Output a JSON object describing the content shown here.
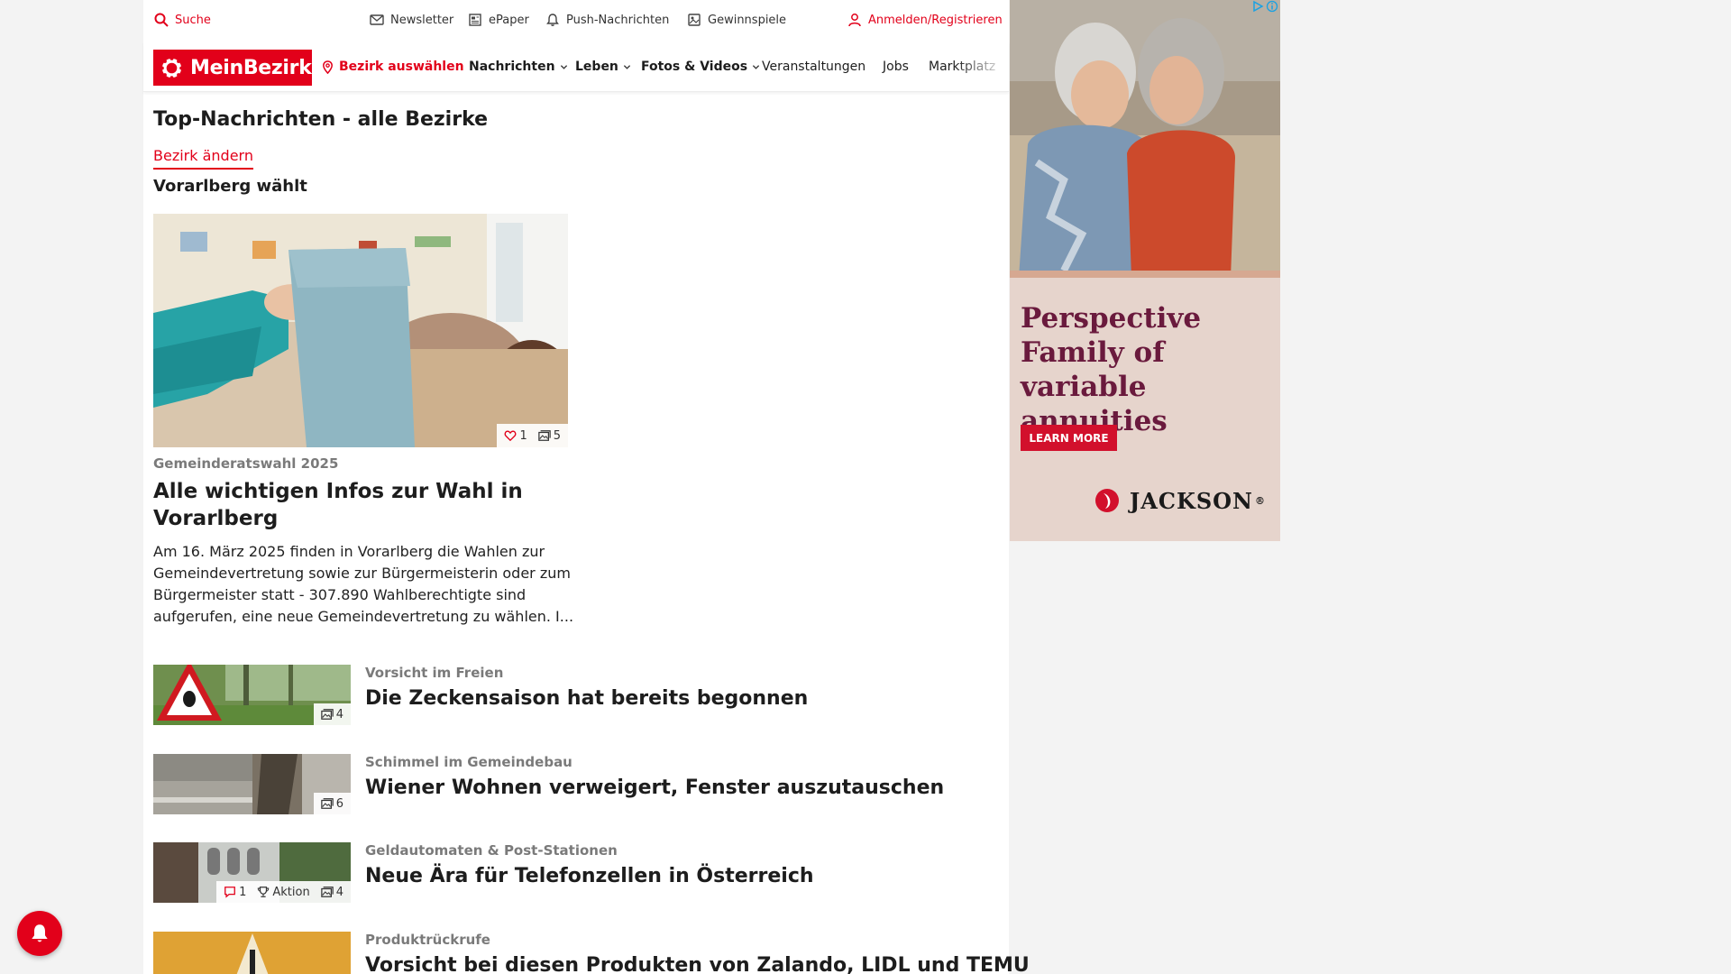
{
  "util_bar": {
    "search": "Suche",
    "newsletter": "Newsletter",
    "epaper": "ePaper",
    "push": "Push-Nachrichten",
    "contests": "Gewinnspiele",
    "login": "Anmelden/Registrieren"
  },
  "nav": {
    "logo": "MeinBezirk",
    "select_district": "Bezirk auswählen",
    "items": [
      "Nachrichten",
      "Leben",
      "Fotos & Videos",
      "Veranstaltungen",
      "Jobs",
      "Marktplatz"
    ]
  },
  "page": {
    "title": "Top-Nachrichten - alle Bezirke",
    "change_district": "Bezirk ändern",
    "section": "Vorarlberg wählt"
  },
  "lead": {
    "likes": "1",
    "photos": "5",
    "kicker": "Gemeinderatswahl 2025",
    "title": "Alle wichtigen Infos zur Wahl in Vorarlberg",
    "teaser": "Am 16. März 2025 finden in Vorarlberg die Wahlen zur Gemeindevertretung sowie zur Bürgermeisterin oder zum Bürgermeister statt - 307.890 Wahlberechtigte sind aufgerufen, eine neue Gemeindevertretung zu wählen. I..."
  },
  "articles": [
    {
      "kicker": "Vorsicht im Freien",
      "title": "Die Zeckensaison hat bereits begonnen",
      "photos": "4"
    },
    {
      "kicker": "Schimmel im Gemeindebau",
      "title": "Wiener Wohnen verweigert, Fenster auszutauschen",
      "photos": "6"
    },
    {
      "kicker": "Geldautomaten & Post-Stationen",
      "title": "Neue Ära für Telefonzellen in Österreich",
      "comments": "1",
      "badge": "Aktion",
      "photos": "4"
    },
    {
      "kicker": "Produktrückrufe",
      "title": "Vorsicht bei diesen Produkten von Zalando, LIDL und TEMU"
    }
  ],
  "ad": {
    "headline": "Perspective Family of variable annuities",
    "cta": "LEARN MORE",
    "brand": "JACKSON",
    "brand_mark": "®"
  },
  "colors": {
    "accent": "#e2001a",
    "ad_headline": "#6a1a3d",
    "ad_bg": "#e6d4cc"
  }
}
